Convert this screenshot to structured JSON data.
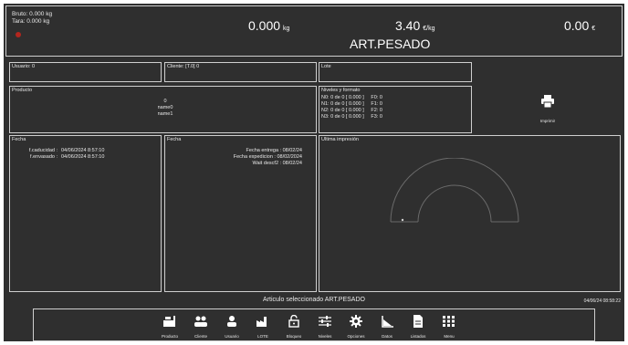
{
  "header": {
    "bruto": "Bruto: 0.000 kg",
    "tara": "Tara: 0.000 kg",
    "weight_value": "0.000",
    "weight_unit": "kg",
    "price_value": "3.40",
    "price_unit": "€/kg",
    "total_value": "0.00",
    "total_unit": "€",
    "article_name": "ART.PESADO"
  },
  "panels": {
    "usuario": "Usuario: 0",
    "cliente": "Cliente: [T.0] 0",
    "lote": "Lote",
    "producto": {
      "title": "Producto",
      "lines": [
        "0",
        "name0",
        "name1"
      ]
    },
    "niveles": {
      "title": "Niveles y formato",
      "rows": [
        "N0: 0 de 0 [ 0.000 ]     F0: 0",
        "N1: 0 de 0 [ 0.000 ]     F1: 0",
        "N2: 0 de 0 [ 0.000 ]     F2: 0",
        "N3: 0 de 0 [ 0.000 ]     F3: 0"
      ]
    },
    "imprimir_label": "Imprimir",
    "fecha_left": {
      "title": "Fecha",
      "rows": [
        {
          "k": "f.caducidad :",
          "v": "04/06/2024 8:57:10"
        },
        {
          "k": "f.envasado :",
          "v": "04/06/2024 8:57:10"
        }
      ]
    },
    "fecha_mid": {
      "title": "Fecha",
      "rows": [
        "Fecha entrega : 08/02/24",
        "Fecha expedicion : 08/02/2024",
        "Wait descf2 : 08/02/24"
      ]
    },
    "ultima": {
      "title": "Ultima impresión"
    }
  },
  "status": {
    "message": "Articulo seleccionado ART.PESADO",
    "datetime": "04/06/24 08:58:22"
  },
  "nav": [
    {
      "name": "producto",
      "label": "Producto",
      "icon": "product-icon"
    },
    {
      "name": "cliente",
      "label": "Cliente",
      "icon": "clients-icon"
    },
    {
      "name": "usuario",
      "label": "Usuario",
      "icon": "user-icon"
    },
    {
      "name": "lote",
      "label": "LOTE",
      "icon": "factory-icon"
    },
    {
      "name": "bloqueo",
      "label": "Bloqueo",
      "icon": "lock-icon"
    },
    {
      "name": "niveles",
      "label": "Niveles",
      "icon": "sliders-icon"
    },
    {
      "name": "opciones",
      "label": "Opciones",
      "icon": "gear-icon"
    },
    {
      "name": "datos",
      "label": "Datos",
      "icon": "chart-icon"
    },
    {
      "name": "listados",
      "label": "Listados",
      "icon": "document-icon"
    },
    {
      "name": "menu",
      "label": "Menu",
      "icon": "grid-icon"
    }
  ]
}
